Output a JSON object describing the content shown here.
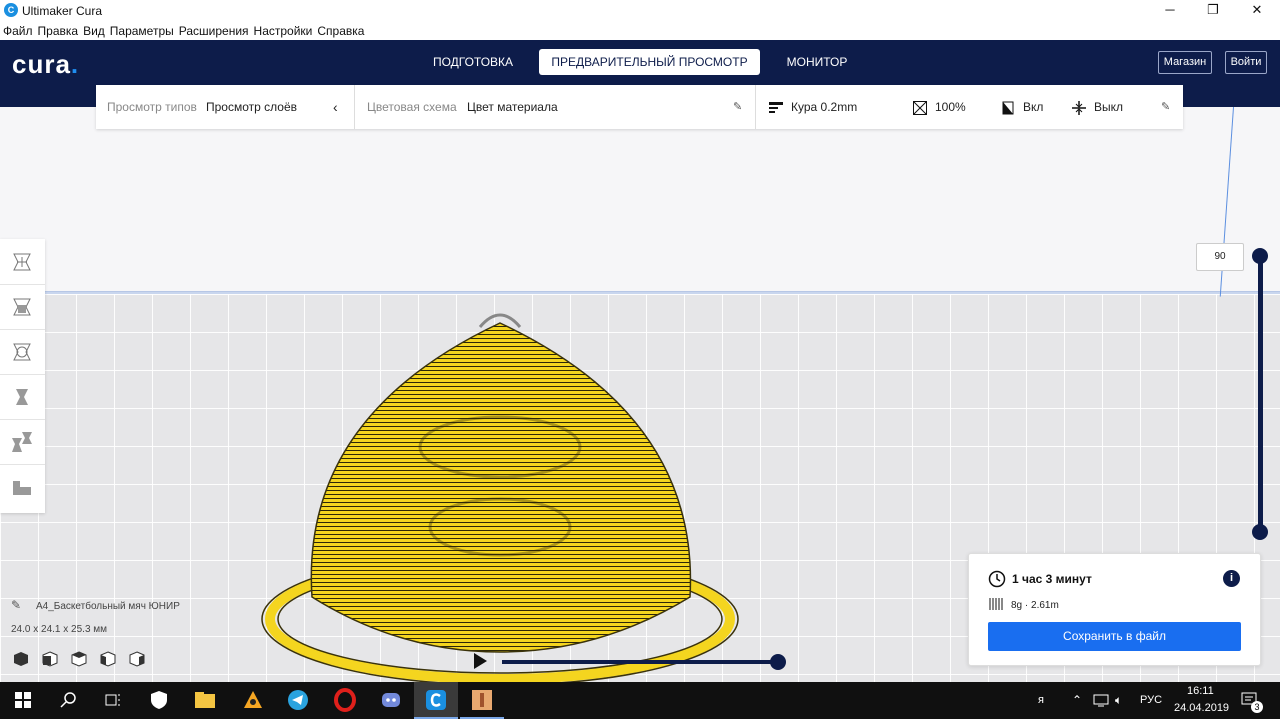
{
  "window": {
    "title": "Ultimaker Cura",
    "icon": "cura-app-icon",
    "controls": [
      "minimize-icon",
      "maximize-icon",
      "close-icon"
    ]
  },
  "menu": [
    "Файл",
    "Правка",
    "Вид",
    "Параметры",
    "Расширения",
    "Настройки",
    "Справка"
  ],
  "header": {
    "logo": "cura",
    "tabs": [
      "ПОДГОТОВКА",
      "ПРЕДВАРИТЕЛЬНЫЙ ПРОСМОТР",
      "МОНИТОР"
    ],
    "active_tab": 1,
    "marketplace_label": "Магазин",
    "signin_label": "Войти"
  },
  "view_settings": {
    "view_type_label": "Просмотр типов",
    "view_type_value": "Просмотр слоёв",
    "color_scheme_label": "Цветовая схема",
    "color_scheme_value": "Цвет материала",
    "profile": "Кура 0.2mm",
    "infill": "100%",
    "support": "Вкл",
    "adhesion": "Выкл"
  },
  "tools": [
    "move-tool-icon",
    "scale-tool-icon",
    "rotate-tool-icon",
    "mirror-tool-icon",
    "per-model-settings-icon",
    "support-blocker-icon"
  ],
  "layer_slider": {
    "current_layer": "90"
  },
  "object": {
    "name": "A4_Баскетбольный мяч ЮНИР",
    "dimensions": "24.0 x 24.1 x 25.3 мм"
  },
  "camera_views": [
    "3d-view-icon",
    "front-view-icon",
    "top-view-icon",
    "left-view-icon",
    "right-view-icon"
  ],
  "print_info": {
    "time": "1 час 3 минут",
    "material": "8g · 2.61m",
    "save_label": "Сохранить в файл"
  },
  "taskbar": {
    "apps": [
      "windows-start-icon",
      "search-icon",
      "task-view-icon",
      "security-icon",
      "file-explorer-icon",
      "archive-icon",
      "telegram-icon",
      "opera-icon",
      "discord-icon",
      "cura-taskbar-icon",
      "app-taskbar-icon"
    ],
    "language": "РУС",
    "time": "16:11",
    "date": "24.04.2019",
    "notifications": "3"
  },
  "colors": {
    "header_bg": "#0d1c4a",
    "accent": "#196ef0",
    "model": "#f4d51f"
  }
}
